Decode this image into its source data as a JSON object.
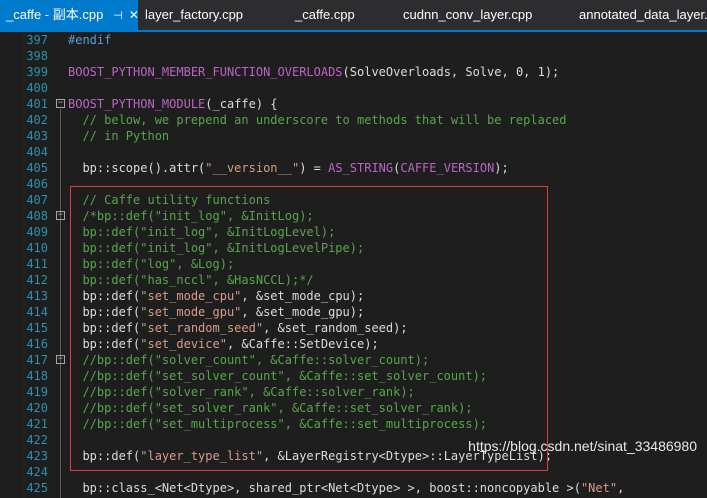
{
  "tabs": [
    {
      "label": "_caffe - 副本.cpp",
      "active": true,
      "pin": "⊣",
      "close": "✕"
    },
    {
      "label": "layer_factory.cpp"
    },
    {
      "label": "_caffe.cpp"
    },
    {
      "label": "cudnn_conv_layer.cpp"
    },
    {
      "label": "annotated_data_layer.c"
    }
  ],
  "colors": {
    "accent": "#007acc",
    "comment": "#57a64a",
    "string": "#d69d85",
    "macro": "#bd63c5",
    "line_number": "#2b91af",
    "highlight_box": "#e03c3c"
  },
  "code_lines": [
    {
      "no": "397",
      "tokens": [
        {
          "t": "#endif",
          "c": "k"
        }
      ]
    },
    {
      "no": "398",
      "tokens": []
    },
    {
      "no": "399",
      "tokens": [
        {
          "t": "BOOST_PYTHON_MEMBER_FUNCTION_OVERLOADS",
          "c": "m"
        },
        {
          "t": "(SolveOverloads, Solve, 0, 1);",
          "c": "t"
        }
      ]
    },
    {
      "no": "400",
      "tokens": []
    },
    {
      "no": "401",
      "fold": "−",
      "tokens": [
        {
          "t": "BOOST_PYTHON_MODULE",
          "c": "m"
        },
        {
          "t": "(_caffe) {",
          "c": "t"
        }
      ]
    },
    {
      "no": "402",
      "fold_start": true,
      "tokens": [
        {
          "t": "  // below, we prepend an underscore to methods that will be replaced",
          "c": "c"
        }
      ]
    },
    {
      "no": "403",
      "tokens": [
        {
          "t": "  // in Python",
          "c": "c"
        }
      ]
    },
    {
      "no": "404",
      "tokens": []
    },
    {
      "no": "405",
      "tokens": [
        {
          "t": "  bp::scope().attr(",
          "c": "t"
        },
        {
          "t": "\"__version__\"",
          "c": "s"
        },
        {
          "t": ") = ",
          "c": "t"
        },
        {
          "t": "AS_STRING",
          "c": "m"
        },
        {
          "t": "(",
          "c": "t"
        },
        {
          "t": "CAFFE_VERSION",
          "c": "m"
        },
        {
          "t": ");",
          "c": "t"
        }
      ]
    },
    {
      "no": "406",
      "tokens": []
    },
    {
      "no": "407",
      "tokens": [
        {
          "t": "  // Caffe utility functions",
          "c": "c"
        }
      ]
    },
    {
      "no": "408",
      "fold": "−",
      "tokens": [
        {
          "t": "  /*bp::def(\"init_log\", &InitLog);",
          "c": "c"
        }
      ]
    },
    {
      "no": "409",
      "tokens": [
        {
          "t": "  bp::def(\"init_log\", &InitLogLevel);",
          "c": "c"
        }
      ]
    },
    {
      "no": "410",
      "tokens": [
        {
          "t": "  bp::def(\"init_log\", &InitLogLevelPipe);",
          "c": "c"
        }
      ]
    },
    {
      "no": "411",
      "tokens": [
        {
          "t": "  bp::def(\"log\", &Log);",
          "c": "c"
        }
      ]
    },
    {
      "no": "412",
      "tokens": [
        {
          "t": "  bp::def(\"has_nccl\", &HasNCCL);*/",
          "c": "c"
        }
      ]
    },
    {
      "no": "413",
      "tokens": [
        {
          "t": "  bp::def(",
          "c": "t"
        },
        {
          "t": "\"set_mode_cpu\"",
          "c": "s"
        },
        {
          "t": ", &set_mode_cpu);",
          "c": "t"
        }
      ]
    },
    {
      "no": "414",
      "tokens": [
        {
          "t": "  bp::def(",
          "c": "t"
        },
        {
          "t": "\"set_mode_gpu\"",
          "c": "s"
        },
        {
          "t": ", &set_mode_gpu);",
          "c": "t"
        }
      ]
    },
    {
      "no": "415",
      "tokens": [
        {
          "t": "  bp::def(",
          "c": "t"
        },
        {
          "t": "\"set_random_seed\"",
          "c": "s"
        },
        {
          "t": ", &set_random_seed);",
          "c": "t"
        }
      ]
    },
    {
      "no": "416",
      "tokens": [
        {
          "t": "  bp::def(",
          "c": "t"
        },
        {
          "t": "\"set_device\"",
          "c": "s"
        },
        {
          "t": ", &Caffe::SetDevice);",
          "c": "t"
        }
      ]
    },
    {
      "no": "417",
      "fold": "−",
      "tokens": [
        {
          "t": "  //bp::def(\"solver_count\", &Caffe::solver_count);",
          "c": "c"
        }
      ]
    },
    {
      "no": "418",
      "tokens": [
        {
          "t": "  //bp::def(\"set_solver_count\", &Caffe::set_solver_count);",
          "c": "c"
        }
      ]
    },
    {
      "no": "419",
      "tokens": [
        {
          "t": "  //bp::def(\"solver_rank\", &Caffe::solver_rank);",
          "c": "c"
        }
      ]
    },
    {
      "no": "420",
      "tokens": [
        {
          "t": "  //bp::def(\"set_solver_rank\", &Caffe::set_solver_rank);",
          "c": "c"
        }
      ]
    },
    {
      "no": "421",
      "tokens": [
        {
          "t": "  //bp::def(\"set_multiprocess\", &Caffe::set_multiprocess);",
          "c": "c"
        }
      ]
    },
    {
      "no": "422",
      "tokens": []
    },
    {
      "no": "423",
      "tokens": [
        {
          "t": "  bp::def(",
          "c": "t"
        },
        {
          "t": "\"layer_type_list\"",
          "c": "s"
        },
        {
          "t": ", &LayerRegistry<Dtype>::LayerTypeList);",
          "c": "t"
        }
      ]
    },
    {
      "no": "424",
      "tokens": []
    },
    {
      "no": "425",
      "tokens": [
        {
          "t": "  bp::class_<Net<Dtype>, shared_ptr<Net<Dtype> >, boost::noncopyable >(",
          "c": "t"
        },
        {
          "t": "\"Net\"",
          "c": "s"
        },
        {
          "t": ", ",
          "c": "t"
        }
      ]
    }
  ],
  "watermark": "https://blog.csdn.net/sinat_33486980"
}
